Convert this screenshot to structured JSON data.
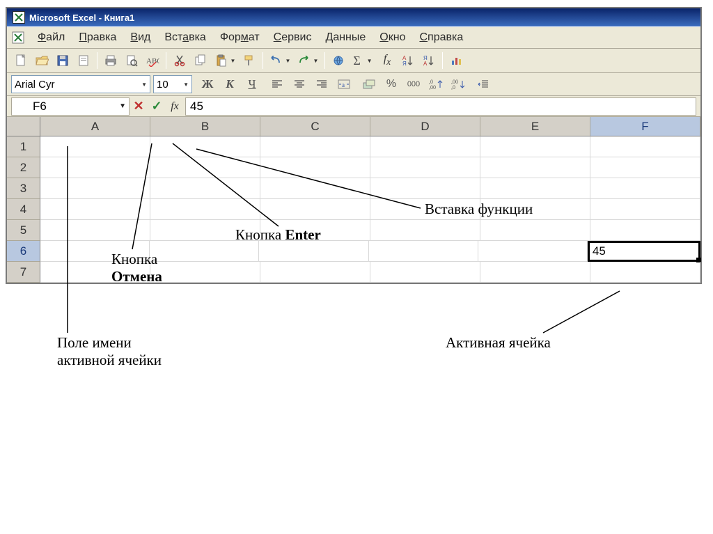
{
  "window": {
    "title": "Microsoft Excel - Книга1"
  },
  "menu": {
    "file": {
      "u": "Ф",
      "rest": "айл"
    },
    "edit": {
      "u": "П",
      "rest": "равка"
    },
    "view": {
      "u": "В",
      "rest": "ид"
    },
    "insert": {
      "u": "",
      "rest": "Вст",
      "u2": "а",
      "rest2": "вка"
    },
    "format": {
      "u": "",
      "rest": "Фор",
      "u2": "м",
      "rest2": "ат"
    },
    "service": {
      "u": "С",
      "rest": "ервис"
    },
    "data": {
      "u": "Д",
      "rest": "анные"
    },
    "window_m": {
      "u": "О",
      "rest": "кно"
    },
    "help": {
      "u": "С",
      "rest": "правка"
    }
  },
  "format_bar": {
    "font_name": "Arial Cyr",
    "font_size": "10",
    "bold": "Ж",
    "italic": "К",
    "underline": "Ч",
    "currency": "%",
    "thousand": "000",
    "inc_dec": "%",
    "dec_inc_a": ",0",
    "dec_inc_b": ",00"
  },
  "formula_bar": {
    "name_box": "F6",
    "cancel": "✕",
    "enter": "✓",
    "fx": "fx",
    "value": "45"
  },
  "columns": [
    "A",
    "B",
    "C",
    "D",
    "E",
    "F"
  ],
  "rows": [
    "1",
    "2",
    "3",
    "4",
    "5",
    "6",
    "7"
  ],
  "active_cell_value": "45",
  "annotations": {
    "name_field": "Поле имени активной ячейки",
    "cancel_btn_l1": "Кнопка",
    "cancel_btn_l2": "Отмена",
    "enter_btn_l1": "Кнопка ",
    "enter_btn_l2": "Enter",
    "insert_fn": "Вставка функции",
    "active_cell": "Активная ячейка"
  }
}
